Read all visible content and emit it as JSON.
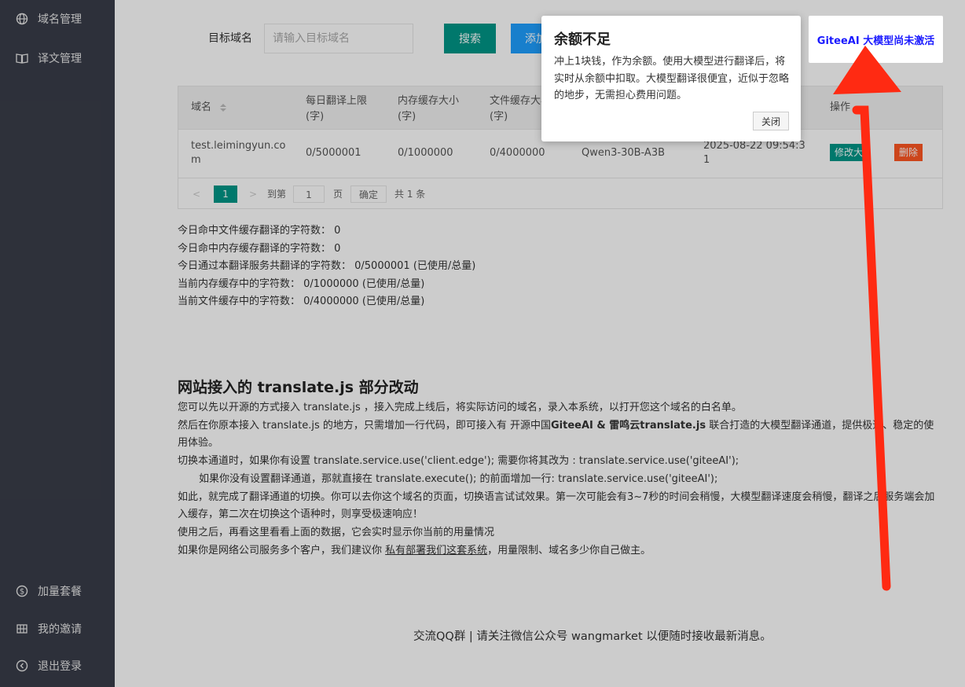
{
  "sidebar": {
    "items": [
      {
        "label": "域名管理",
        "icon": "globe-icon"
      },
      {
        "label": "译文管理",
        "icon": "book-icon"
      },
      {
        "label": "加量套餐",
        "icon": "dollar-icon"
      },
      {
        "label": "我的邀请",
        "icon": "grid-icon"
      },
      {
        "label": "退出登录",
        "icon": "logout-icon"
      }
    ]
  },
  "search": {
    "label": "目标域名",
    "placeholder": "请输入目标域名",
    "search_button": "搜索",
    "add_button": "添加"
  },
  "table": {
    "headers": [
      "域名",
      "每日翻译上限(字)",
      "内存缓存大小(字)",
      "文件缓存大小",
      "操作"
    ],
    "header_lines": {
      "daily_1": "每日翻译上限",
      "daily_2": "(字)",
      "mem_1": "内存缓存大小",
      "mem_2": "(字)",
      "file_1": "文件缓存大小",
      "file_2": "(字)"
    },
    "row": {
      "domain_1": "test.leimingyun.co",
      "domain_2": "m",
      "daily": "0/5000001",
      "memory": "0/1000000",
      "file": "0/4000000",
      "model": "Qwen3-30B-A3B",
      "time_1": "2025-08-22 09:54:3",
      "time_2": "1",
      "edit": "修改大",
      "delete": "删除"
    },
    "pager": {
      "current": "1",
      "goto": "到第",
      "page_input": "1",
      "page_unit": "页",
      "confirm": "确定",
      "total": "共 1 条"
    }
  },
  "stats": [
    "今日命中文件缓存翻译的字符数：  0",
    "今日命中内存缓存翻译的字符数：  0",
    "今日通过本翻译服务共翻译的字符数：  0/5000001 (已使用/总量)",
    "当前内存缓存中的字符数：  0/1000000 (已使用/总量)",
    "当前文件缓存中的字符数：  0/4000000 (已使用/总量)"
  ],
  "doc": {
    "title": "网站接入的 translate.js 部分改动",
    "p1": "您可以先以开源的方式接入 translate.js ，接入完成上线后，将实际访问的域名，录入本系统，以打开您这个域名的白名单。",
    "p2a": "然后在你原本接入 translate.js 的地方，只需增加一行代码，即可接入有 开源中国",
    "p2b": "GiteeAI & 雷鸣云translate.js",
    "p2c": " 联合打造的大模型翻译通道，提供极速、稳定的使用体验。",
    "p3": "切换本通道时，如果你有设置 translate.service.use('client.edge'); 需要你将其改为 : translate.service.use('giteeAI');",
    "p4": "如果你没有设置翻译通道，那就直接在 translate.execute(); 的前面增加一行: translate.service.use('giteeAI');",
    "p5": "如此，就完成了翻译通道的切换。你可以去你这个域名的页面，切换语言试试效果。第一次可能会有3~7秒的时间会稍慢，大模型翻译速度会稍慢，翻译之后服务端会加入缓存，第二次在切换这个语种时，则享受极速响应！",
    "p6": "使用之后，再看这里看看上面的数据，它会实时显示你当前的用量情况",
    "p7a": "如果你是网络公司服务多个客户，我们建议你 ",
    "p7b": "私有部署我们这套系统",
    "p7c": "，用量限制、域名多少你自己做主。"
  },
  "footer": "交流QQ群 | 请关注微信公众号 wangmarket 以便随时接收最新消息。",
  "popup": {
    "title": "余额不足",
    "body": "冲上1块钱，作为余额。使用大模型进行翻译后，将实时从余额中扣取。大模型翻译很便宜，近似于忽略的地步，无需担心费用问题。",
    "close": "关闭"
  },
  "notice": "GiteeAI 大模型尚未激活",
  "colors": {
    "sidebar": "#393d49",
    "primary": "#009688",
    "blue": "#1e9fff",
    "danger": "#ff5722",
    "arrow": "#ff2a12"
  }
}
